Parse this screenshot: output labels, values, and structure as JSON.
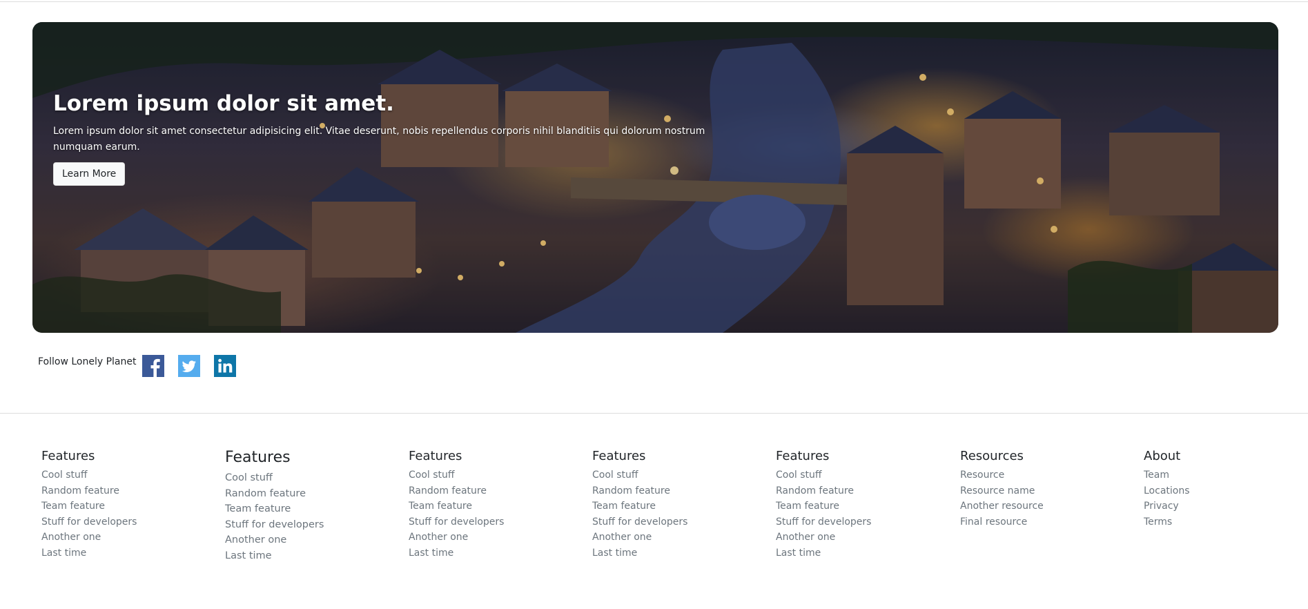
{
  "hero": {
    "title": "Lorem ipsum dolor sit amet.",
    "text": "Lorem ipsum dolor sit amet consectetur adipisicing elit. Vitae deserunt, nobis repellendus corporis nihil blanditiis qui dolorum nostrum numquam earum.",
    "button_label": "Learn More"
  },
  "follow": {
    "label": "Follow Lonely Planet",
    "icons": [
      "facebook-icon",
      "twitter-icon",
      "linkedin-icon"
    ],
    "colors": {
      "facebook": "#3b5998",
      "twitter": "#55acee",
      "linkedin": "#0e76a8"
    }
  },
  "footer": {
    "columns": [
      {
        "title": "Features",
        "items": [
          "Cool stuff",
          "Random feature",
          "Team feature",
          "Stuff for developers",
          "Another one",
          "Last time"
        ]
      },
      {
        "title": "Features",
        "items": [
          "Cool stuff",
          "Random feature",
          "Team feature",
          "Stuff for developers",
          "Another one",
          "Last time"
        ]
      },
      {
        "title": "Features",
        "items": [
          "Cool stuff",
          "Random feature",
          "Team feature",
          "Stuff for developers",
          "Another one",
          "Last time"
        ]
      },
      {
        "title": "Features",
        "items": [
          "Cool stuff",
          "Random feature",
          "Team feature",
          "Stuff for developers",
          "Another one",
          "Last time"
        ]
      },
      {
        "title": "Features",
        "items": [
          "Cool stuff",
          "Random feature",
          "Team feature",
          "Stuff for developers",
          "Another one",
          "Last time"
        ]
      },
      {
        "title": "Resources",
        "items": [
          "Resource",
          "Resource name",
          "Another resource",
          "Final resource"
        ]
      },
      {
        "title": "About",
        "items": [
          "Team",
          "Locations",
          "Privacy",
          "Terms"
        ]
      }
    ]
  }
}
